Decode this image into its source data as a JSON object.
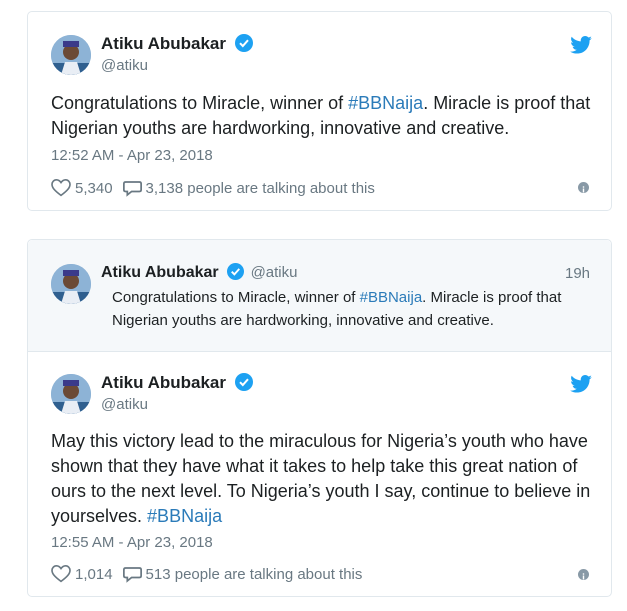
{
  "colors": {
    "link": "#2b7bb9",
    "secondary": "#697882",
    "border": "#e1e8ed",
    "twitter_blue": "#1da1f2"
  },
  "tweet1": {
    "author_name": "Atiku Abubakar",
    "handle": "@atiku",
    "text_part1": "Congratulations to Miracle, winner of ",
    "hashtag": "#BBNaija",
    "text_part2": ". Miracle is proof that Nigerian youths are hardworking, innovative and creative.",
    "timestamp": "12:52 AM - Apr 23, 2018",
    "likes": "5,340",
    "talking": "3,138 people are talking about this"
  },
  "tweet2": {
    "quoted": {
      "author_name": "Atiku Abubakar",
      "handle": "@atiku",
      "time": "19h",
      "text_part1": "Congratulations to Miracle, winner of ",
      "hashtag": "#BBNaija",
      "text_part2": ". Miracle is proof that Nigerian youths are hardworking, innovative and creative."
    },
    "author_name": "Atiku Abubakar",
    "handle": "@atiku",
    "text": "May this victory lead to the miraculous for Nigeria’s youth who have shown that they have what it takes to help take this great nation of ours to the next level. To Nigeria’s youth I say, continue to believe in yourselves. ",
    "hashtag": "#BBNaija",
    "timestamp": "12:55 AM - Apr 23, 2018",
    "likes": "1,014",
    "talking": "513 people are talking about this"
  }
}
